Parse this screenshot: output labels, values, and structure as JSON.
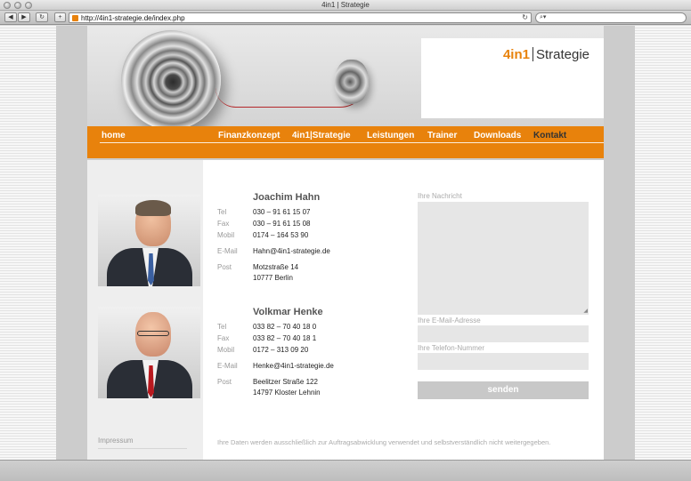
{
  "window": {
    "title": "4in1 | Strategie"
  },
  "browser": {
    "back_label": "◀",
    "forward_label": "▶",
    "reload_label": "↻",
    "add_label": "+",
    "url": "http://4in1-strategie.de/index.php",
    "search_placeholder": ""
  },
  "logo": {
    "part1": "4in1",
    "part2": "Strategie"
  },
  "nav": {
    "items": [
      {
        "label": "home"
      },
      {
        "label": "Finanzkonzept"
      },
      {
        "label": "4in1|Strategie"
      },
      {
        "label": "Leistungen"
      },
      {
        "label": "Trainer"
      },
      {
        "label": "Downloads"
      },
      {
        "label": "Kontakt"
      }
    ]
  },
  "labels": {
    "tel": "Tel",
    "fax": "Fax",
    "mobil": "Mobil",
    "email": "E-Mail",
    "post": "Post"
  },
  "contacts": [
    {
      "name": "Joachim Hahn",
      "tel": "030 – 91 61 15 07",
      "fax": "030 – 91 61 15 08",
      "mobil": "0174 – 164 53 90",
      "email": "Hahn@4in1-strategie.de",
      "street": "Motzstraße 14",
      "city": "10777 Berlin"
    },
    {
      "name": "Volkmar Henke",
      "tel": "033 82 – 70 40 18 0",
      "fax": "033 82 – 70 40 18 1",
      "mobil": "0172 – 313 09 20",
      "email": "Henke@4in1-strategie.de",
      "street": "Beelitzer Straße 122",
      "city": "14797 Kloster Lehnin"
    }
  ],
  "form": {
    "message_label": "Ihre Nachricht",
    "email_label": "Ihre E-Mail-Adresse",
    "phone_label": "Ihre Telefon-Nummer",
    "submit_label": "senden"
  },
  "footer": {
    "impressum": "Impressum",
    "disclaimer": "Ihre Daten werden ausschließlich zur Auftragsabwicklung verwendet und selbstverständlich nicht weitergegeben."
  },
  "colors": {
    "accent": "#e8820c",
    "nav_active": "#333333",
    "button": "#c8c8c8"
  }
}
